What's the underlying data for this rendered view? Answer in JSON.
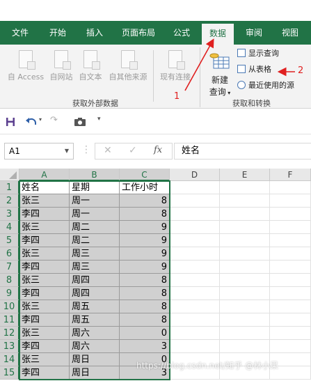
{
  "ribbon": {
    "tabs": [
      "文件",
      "开始",
      "插入",
      "页面布局",
      "公式",
      "数据",
      "审阅",
      "视图"
    ],
    "active_tab": "数据"
  },
  "get_external_data": {
    "buttons": [
      "自 Access",
      "自网站",
      "自文本",
      "自其他来源",
      "现有连接"
    ],
    "group_label": "获取外部数据"
  },
  "get_transform": {
    "new_query_line1": "新建",
    "new_query_line2": "查询",
    "items": [
      "显示查询",
      "从表格",
      "最近使用的源"
    ],
    "group_label": "获取和转换"
  },
  "annotations": [
    "1",
    "2"
  ],
  "name_box": "A1",
  "formula_bar": {
    "cancel": "✕",
    "enter": "✓",
    "fx": "fx",
    "content": "姓名"
  },
  "sheet": {
    "columns": [
      "A",
      "B",
      "C",
      "D",
      "E",
      "F"
    ],
    "row_numbers": [
      "1",
      "2",
      "3",
      "4",
      "5",
      "6",
      "7",
      "8",
      "9",
      "10",
      "11",
      "12",
      "13",
      "14",
      "15"
    ],
    "rows": [
      [
        "姓名",
        "星期",
        "工作小时"
      ],
      [
        "张三",
        "周一",
        "8"
      ],
      [
        "李四",
        "周一",
        "8"
      ],
      [
        "张三",
        "周二",
        "9"
      ],
      [
        "李四",
        "周二",
        "9"
      ],
      [
        "张三",
        "周三",
        "9"
      ],
      [
        "李四",
        "周三",
        "9"
      ],
      [
        "张三",
        "周四",
        "8"
      ],
      [
        "李四",
        "周四",
        "8"
      ],
      [
        "张三",
        "周五",
        "8"
      ],
      [
        "李四",
        "周五",
        "8"
      ],
      [
        "张三",
        "周六",
        "0"
      ],
      [
        "李四",
        "周六",
        "3"
      ],
      [
        "张三",
        "周日",
        "0"
      ],
      [
        "李四",
        "周日",
        "3"
      ]
    ]
  },
  "watermark": "https://blog.csdn.net/知乎 @林小呆",
  "colors": {
    "ribbon_green": "#217346",
    "arrow_red": "#e02020",
    "selection_shade": "#d0d0d0"
  }
}
